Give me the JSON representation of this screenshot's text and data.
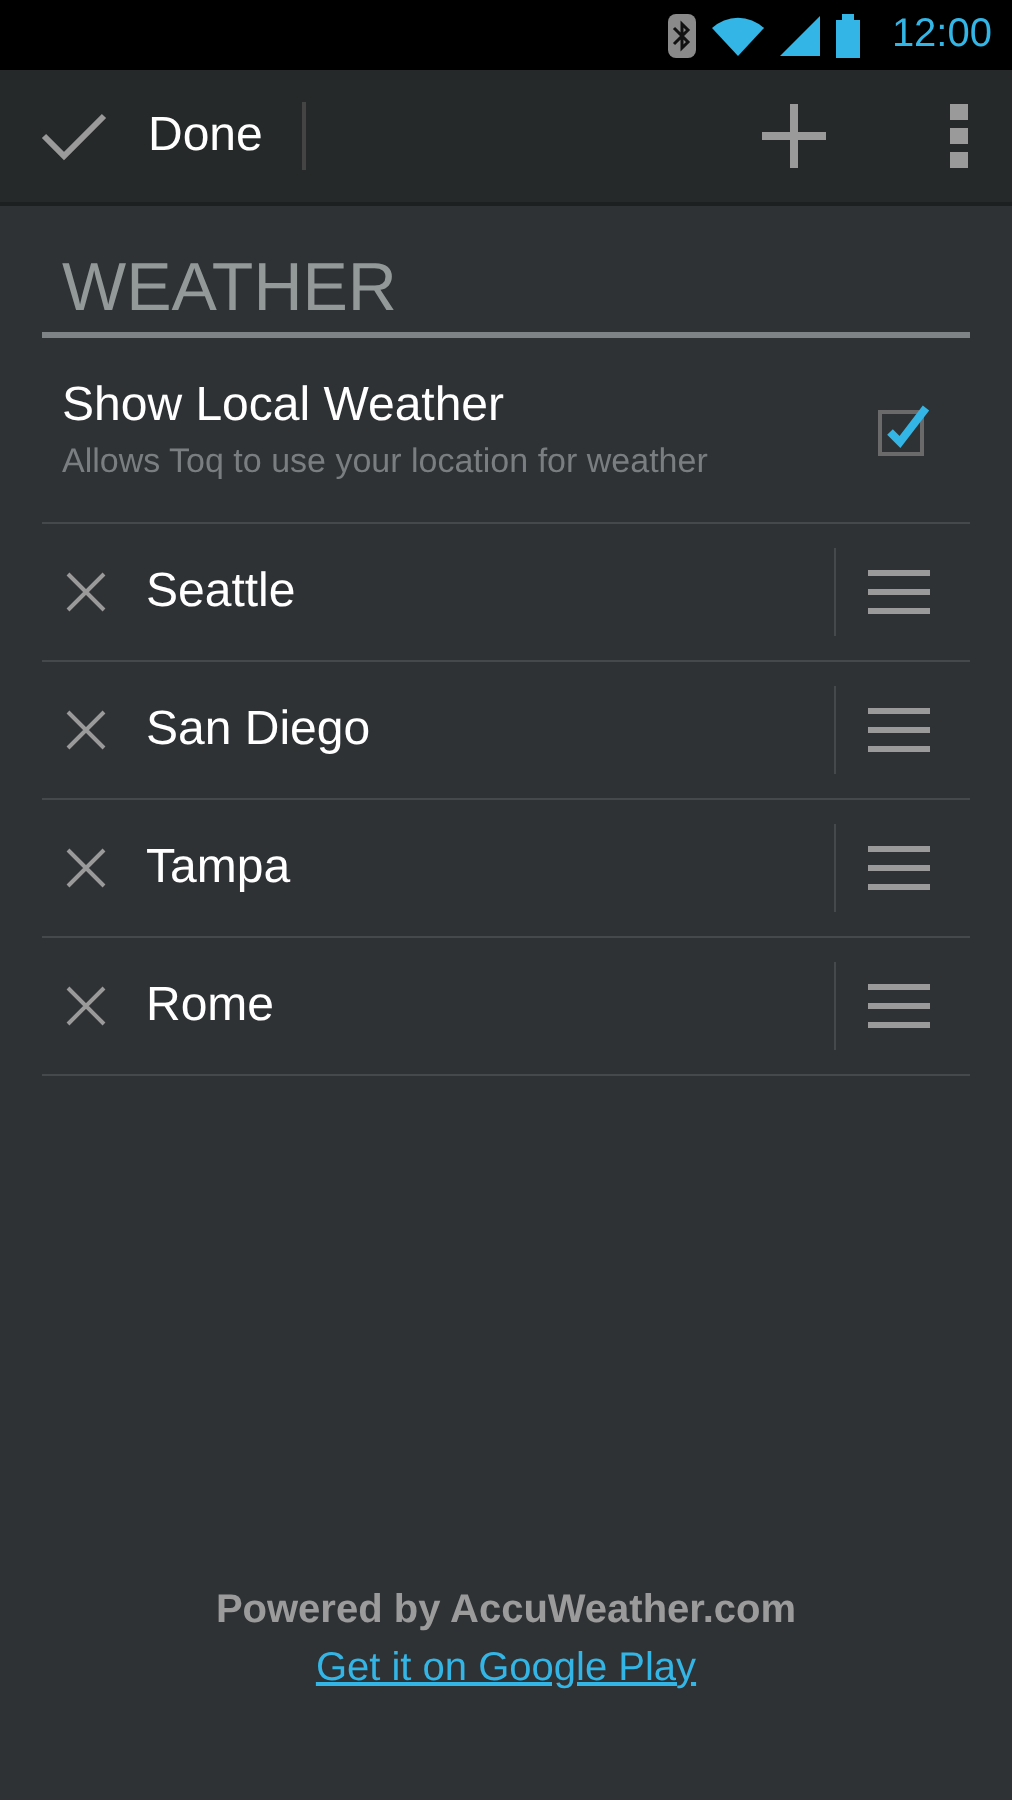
{
  "status_bar": {
    "time": "12:00"
  },
  "action_bar": {
    "done_label": "Done"
  },
  "section": {
    "title": "WEATHER"
  },
  "local_weather": {
    "title": "Show Local Weather",
    "subtitle": "Allows Toq to use your location for weather",
    "checked": true
  },
  "cities": [
    {
      "name": "Seattle"
    },
    {
      "name": "San Diego"
    },
    {
      "name": "Tampa"
    },
    {
      "name": "Rome"
    }
  ],
  "footer": {
    "powered_by": "Powered by AccuWeather.com",
    "link": "Get it on Google Play"
  }
}
